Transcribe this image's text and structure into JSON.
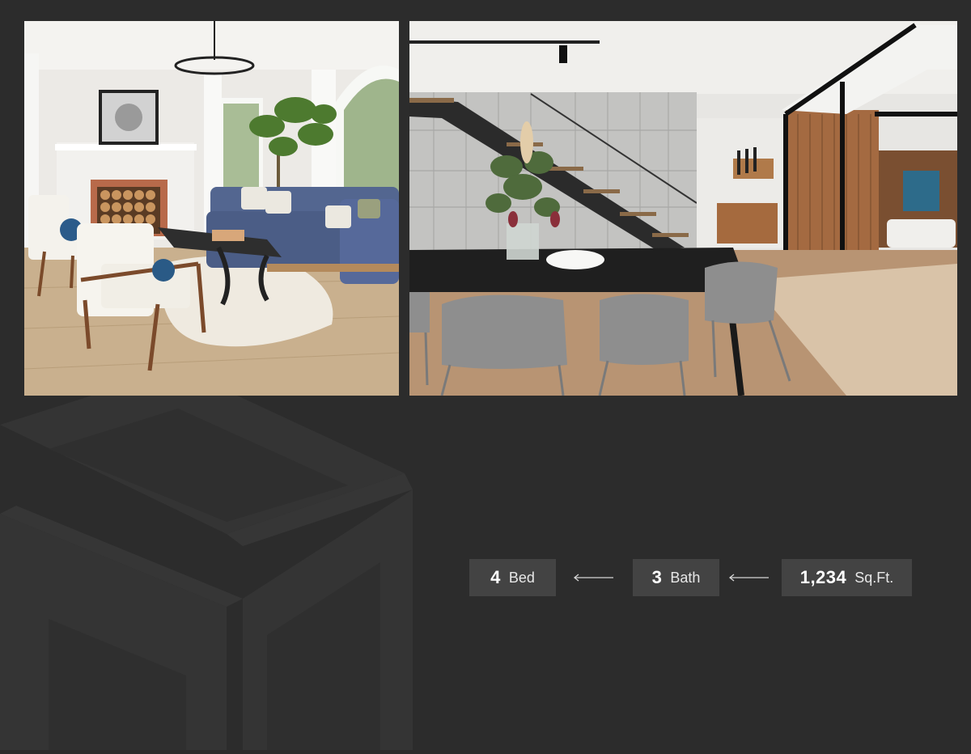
{
  "photos": [
    {
      "name": "living-room-photo",
      "subject": "living room"
    },
    {
      "name": "dining-room-photo",
      "subject": "dining room"
    }
  ],
  "stats": {
    "bed": {
      "value": "4",
      "unit": "Bed"
    },
    "bath": {
      "value": "3",
      "unit": "Bath"
    },
    "sqft": {
      "value": "1,234",
      "unit": "Sq.Ft."
    }
  },
  "icons": {
    "arrow": "arrow-left-icon",
    "watermark": "brand-logo-watermark"
  },
  "colors": {
    "background": "#2c2c2c",
    "stat_box": "#434343",
    "text": "#ffffff"
  }
}
